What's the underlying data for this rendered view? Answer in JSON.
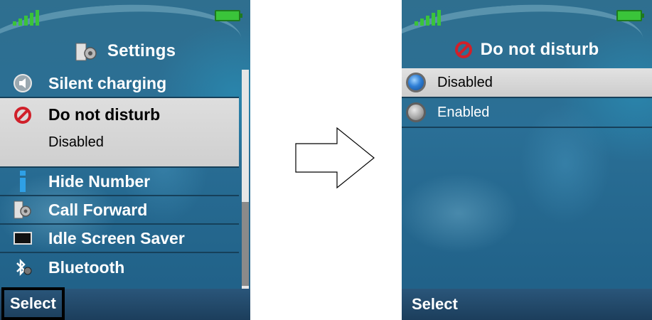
{
  "left_screen": {
    "title": "Settings",
    "title_icon": "settings-gear-icon",
    "items": [
      {
        "label": "Silent charging",
        "icon": "speaker-icon"
      },
      {
        "label": "Do not disturb",
        "icon": "no-entry-icon",
        "value": "Disabled",
        "selected": true
      },
      {
        "label": "Hide Number",
        "icon": "info-icon"
      },
      {
        "label": "Call Forward",
        "icon": "settings-gear-icon"
      },
      {
        "label": "Idle Screen Saver",
        "icon": "monitor-icon"
      },
      {
        "label": "Bluetooth",
        "icon": "bluetooth-icon"
      }
    ],
    "softkey": "Select",
    "softkey_highlighted": true
  },
  "transition": {
    "icon": "right-arrow-icon"
  },
  "right_screen": {
    "title": "Do not disturb",
    "title_icon": "no-entry-icon",
    "options": [
      {
        "label": "Disabled",
        "selected": true
      },
      {
        "label": "Enabled",
        "selected": false
      }
    ],
    "softkey": "Select"
  },
  "colors": {
    "background": "#2a6f96",
    "selection": "#d4d4d4",
    "softbar": "#1c3e5c",
    "battery": "#3ac43a",
    "no_entry": "#d0202a",
    "info_icon": "#2fa0e6"
  }
}
